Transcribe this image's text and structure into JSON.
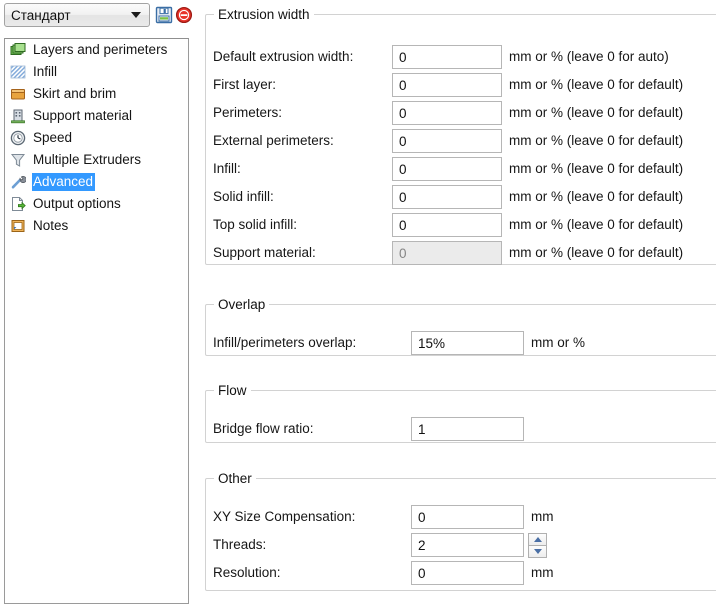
{
  "toolbar": {
    "preset_value": "Стандарт",
    "save_icon": "save-floppy-icon",
    "delete_icon": "delete-circle-icon"
  },
  "sidebar": {
    "items": [
      {
        "label": "Layers and perimeters",
        "icon": "layers-icon",
        "selected": false
      },
      {
        "label": "Infill",
        "icon": "infill-hatch-icon",
        "selected": false
      },
      {
        "label": "Skirt and brim",
        "icon": "skirt-box-icon",
        "selected": false
      },
      {
        "label": "Support material",
        "icon": "support-tower-icon",
        "selected": false
      },
      {
        "label": "Speed",
        "icon": "speed-clock-icon",
        "selected": false
      },
      {
        "label": "Multiple Extruders",
        "icon": "funnel-icon",
        "selected": false
      },
      {
        "label": "Advanced",
        "icon": "wrench-icon",
        "selected": true
      },
      {
        "label": "Output options",
        "icon": "output-page-icon",
        "selected": false
      },
      {
        "label": "Notes",
        "icon": "notes-icon",
        "selected": false
      }
    ]
  },
  "groups": {
    "extrusion_width": {
      "legend": "Extrusion width",
      "rows": [
        {
          "label": "Default extrusion width:",
          "value": "0",
          "unit": "mm or % (leave 0 for auto)",
          "disabled": false
        },
        {
          "label": "First layer:",
          "value": "0",
          "unit": "mm or % (leave 0 for default)",
          "disabled": false
        },
        {
          "label": "Perimeters:",
          "value": "0",
          "unit": "mm or % (leave 0 for default)",
          "disabled": false
        },
        {
          "label": "External perimeters:",
          "value": "0",
          "unit": "mm or % (leave 0 for default)",
          "disabled": false
        },
        {
          "label": "Infill:",
          "value": "0",
          "unit": "mm or % (leave 0 for default)",
          "disabled": false
        },
        {
          "label": "Solid infill:",
          "value": "0",
          "unit": "mm or % (leave 0 for default)",
          "disabled": false
        },
        {
          "label": "Top solid infill:",
          "value": "0",
          "unit": "mm or % (leave 0 for default)",
          "disabled": false
        },
        {
          "label": "Support material:",
          "value": "0",
          "unit": "mm or % (leave 0 for default)",
          "disabled": true
        }
      ]
    },
    "overlap": {
      "legend": "Overlap",
      "rows": [
        {
          "label": "Infill/perimeters overlap:",
          "value": "15%",
          "unit": "mm or %"
        }
      ]
    },
    "flow": {
      "legend": "Flow",
      "rows": [
        {
          "label": "Bridge flow ratio:",
          "value": "1",
          "unit": ""
        }
      ]
    },
    "other": {
      "legend": "Other",
      "rows": [
        {
          "label": "XY Size Compensation:",
          "value": "0",
          "unit": "mm",
          "spinner": false
        },
        {
          "label": "Threads:",
          "value": "2",
          "unit": "",
          "spinner": true
        },
        {
          "label": "Resolution:",
          "value": "0",
          "unit": "mm",
          "spinner": false
        }
      ]
    }
  },
  "colors": {
    "selection_blue": "#3399ff",
    "group_border": "#d2d2d2",
    "field_border": "#b6b6b6",
    "disabled_bg": "#ebebeb"
  }
}
